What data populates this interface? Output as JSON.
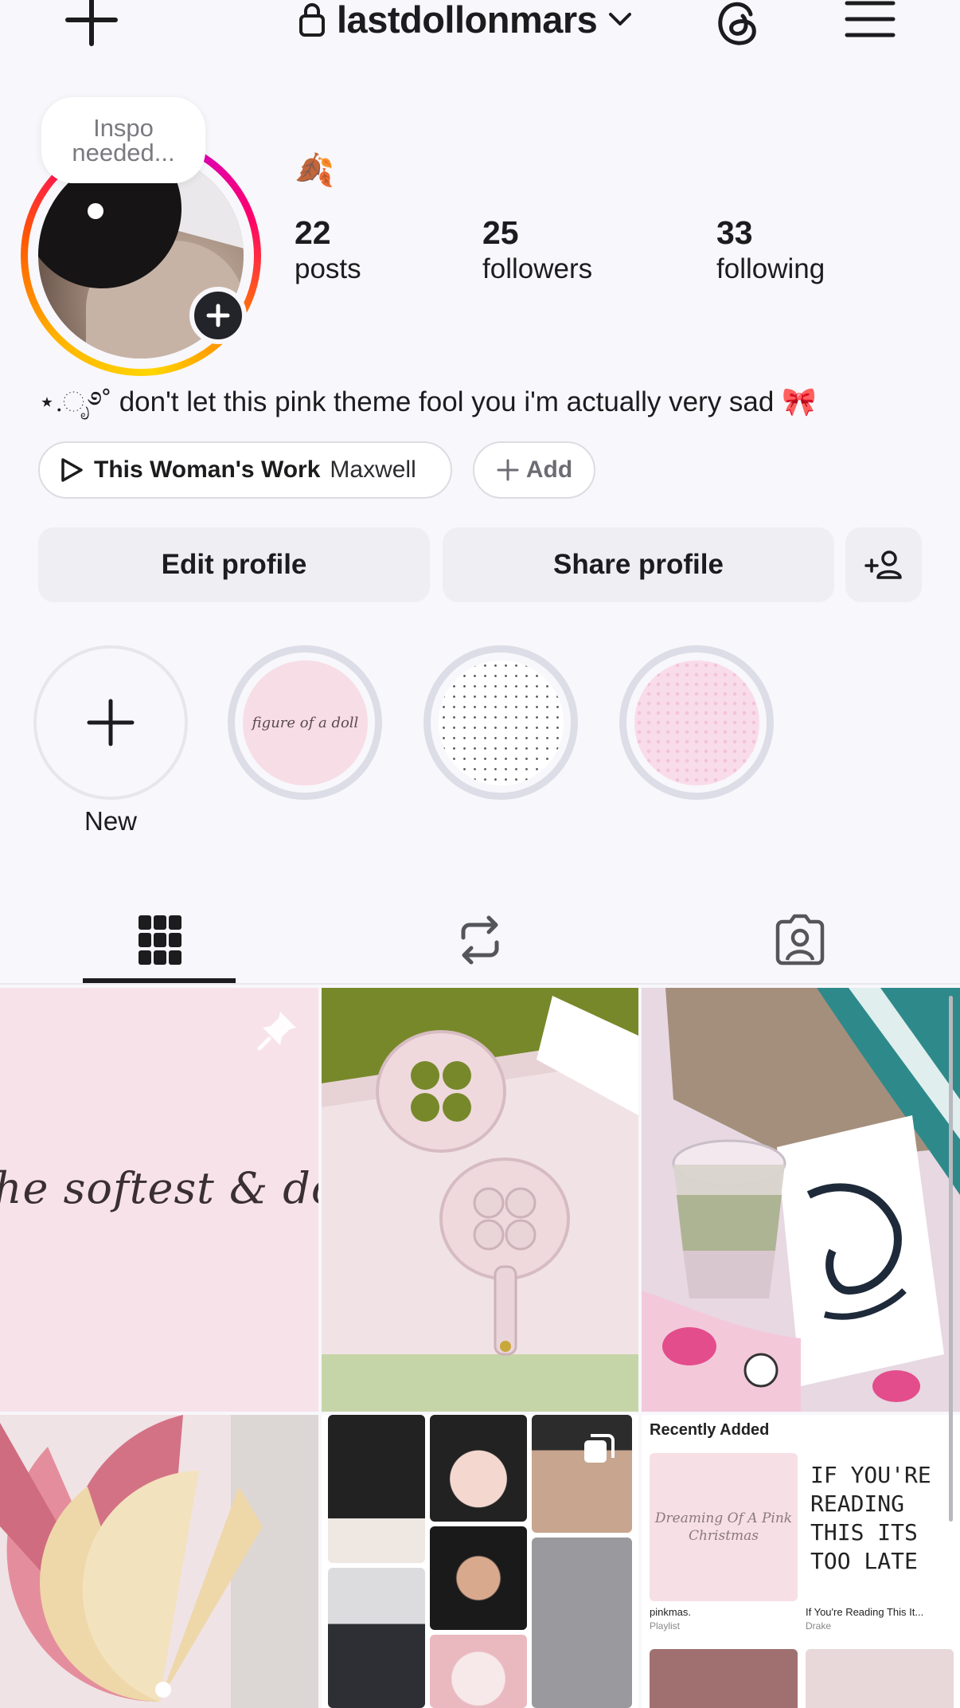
{
  "header": {
    "username": "lastdollonmars"
  },
  "profile": {
    "note": [
      "Inspo",
      "needed..."
    ],
    "emoji": "🍂",
    "stats": [
      {
        "count": "22",
        "label": "posts"
      },
      {
        "count": "25",
        "label": "followers"
      },
      {
        "count": "33",
        "label": "following"
      }
    ],
    "bio": "⋆.ೃ࿔˚ don't let this pink theme fool you i'm actually very sad 🎀",
    "music": {
      "song": "This Woman's Work",
      "artist": "Maxwell"
    },
    "add_label": "Add"
  },
  "actions": {
    "edit": "Edit profile",
    "share": "Share profile"
  },
  "highlights": {
    "new_label": "New",
    "cover1_text": "figure of a doll"
  },
  "grid": {
    "post1_text": "the softest & dollies",
    "playlist": {
      "header": "Recently Added",
      "album1_art": "Dreaming Of A Pink Christmas",
      "album1_name": "pinkmas.",
      "album1_sub": "Playlist",
      "album2_art": "IF YOU'RE READING THIS ITS TOO LATE",
      "album2_name": "If You're Reading This It...",
      "album2_sub": "Drake"
    }
  },
  "colors": {
    "background": "#f8f7fb",
    "button_bg": "#eeeef3",
    "text": "#1c1c1e"
  }
}
